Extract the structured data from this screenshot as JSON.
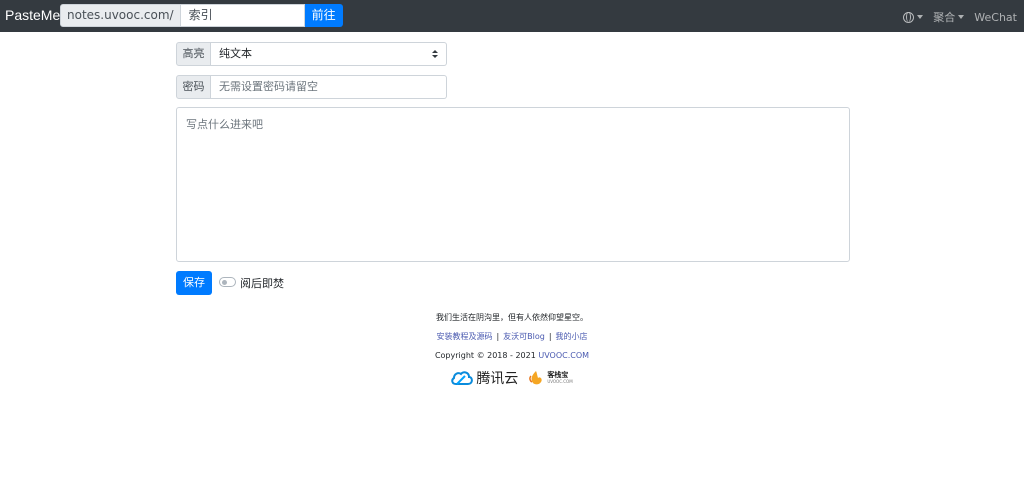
{
  "navbar": {
    "brand": "PasteMe",
    "url_prefix": "notes.uvooc.com/",
    "search_placeholder": "索引",
    "go_label": "前往",
    "menu_label": "聚合",
    "wechat_label": "WeChat",
    "icons": [
      "globe-icon",
      "caret-down-icon"
    ]
  },
  "form": {
    "highlight_label": "高亮",
    "highlight_value": "纯文本",
    "password_label": "密码",
    "password_placeholder": "无需设置密码请留空",
    "content_placeholder": "写点什么进来吧",
    "save_label": "保存",
    "burn_label": "阅后即焚",
    "burn_enabled": false
  },
  "footer": {
    "tagline": "我们生活在阴沟里，但有人依然仰望星空。",
    "links": [
      "安装教程及源码",
      "友沃可Blog",
      "我的小店"
    ],
    "copyright_prefix": "Copyright © 2018 - 2021 ",
    "copyright_link": "UVOOC.COM",
    "sponsor_tencent": "腾讯云",
    "sponsor_kdx_name": "客栈宝",
    "sponsor_kdx_sub": "UVOOC.COM"
  },
  "colors": {
    "navbar_bg": "#343a40",
    "primary": "#007bff",
    "link": "#4a5ab0"
  }
}
